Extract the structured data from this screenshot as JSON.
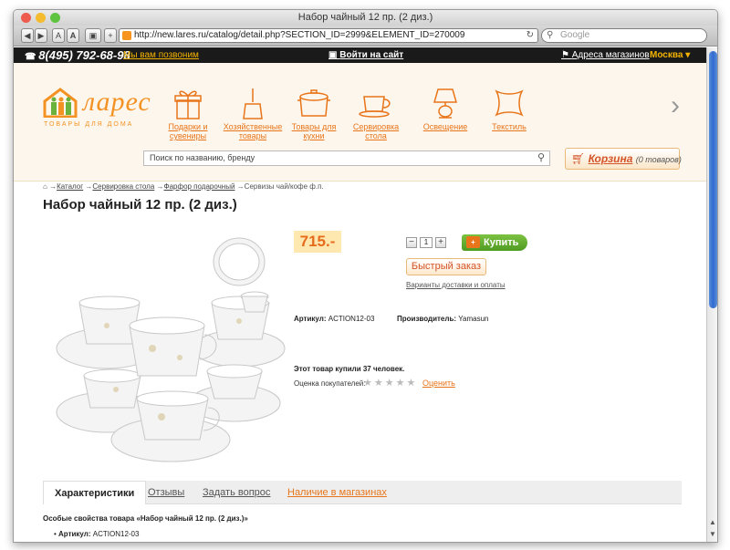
{
  "window": {
    "title": "Набор чайный 12 пр. (2 диз.)",
    "url": "http://new.lares.ru/catalog/detail.php?SECTION_ID=2999&ELEMENT_ID=270009",
    "search_placeholder": "Google",
    "toolbar_buttons": [
      "A",
      "A"
    ]
  },
  "topbar": {
    "phone": "8(495) 792-68-98",
    "callback": "Мы вам позвоним",
    "login": "Войти на сайт",
    "stores": "Адреса магазинов",
    "city": "Москва ▾"
  },
  "header": {
    "logo_word": "ларес",
    "logo_tagline": "ТОВАРЫ ДЛЯ ДОМА",
    "categories": [
      {
        "line1": "Подарки и",
        "line2": "сувениры",
        "icon": "gift-icon"
      },
      {
        "line1": "Хозяйственные",
        "line2": "товары",
        "icon": "dustpan-icon"
      },
      {
        "line1": "Товары для",
        "line2": "кухни",
        "icon": "pot-icon"
      },
      {
        "line1": "Сервировка",
        "line2": "стола",
        "icon": "teacup-icon"
      },
      {
        "line1": "Освещение",
        "line2": "",
        "icon": "lamp-icon"
      },
      {
        "line1": "Текстиль",
        "line2": "",
        "icon": "pillow-icon"
      }
    ],
    "search_placeholder": "Поиск по названию, бренду",
    "cart_label": "Корзина",
    "cart_count": "(0 товаров)"
  },
  "breadcrumb": {
    "items": [
      "Каталог",
      "Сервировка стола",
      "Фарфор подарочный"
    ],
    "current": "Сервизы чай/кофе ф.п."
  },
  "product": {
    "title": "Набор чайный 12 пр. (2 диз.)",
    "price": "715.-",
    "quantity": "1",
    "buy_label": "Купить",
    "quick_order": "Быстрый заказ",
    "delivery_link": "Варианты доставки и оплаты",
    "article_label": "Артикул:",
    "article_value": "ACTION12-03",
    "maker_label": "Производитель:",
    "maker_value": "Yamasun",
    "bought_text": "Этот товар купили 37 человек.",
    "rating_label": "Оценка покупателей:",
    "rating_stars": "★★★★★",
    "rate_link": "Оценить"
  },
  "tabs": [
    {
      "label": "Характеристики"
    },
    {
      "label": "Отзывы"
    },
    {
      "label": "Задать вопрос"
    },
    {
      "label": "Наличие в магазинах"
    }
  ],
  "specs": {
    "title": "Особые свойства товара «Набор чайный 12 пр. (2 диз.)»",
    "row_label": "Артикул:",
    "row_value": "ACTION12-03"
  }
}
